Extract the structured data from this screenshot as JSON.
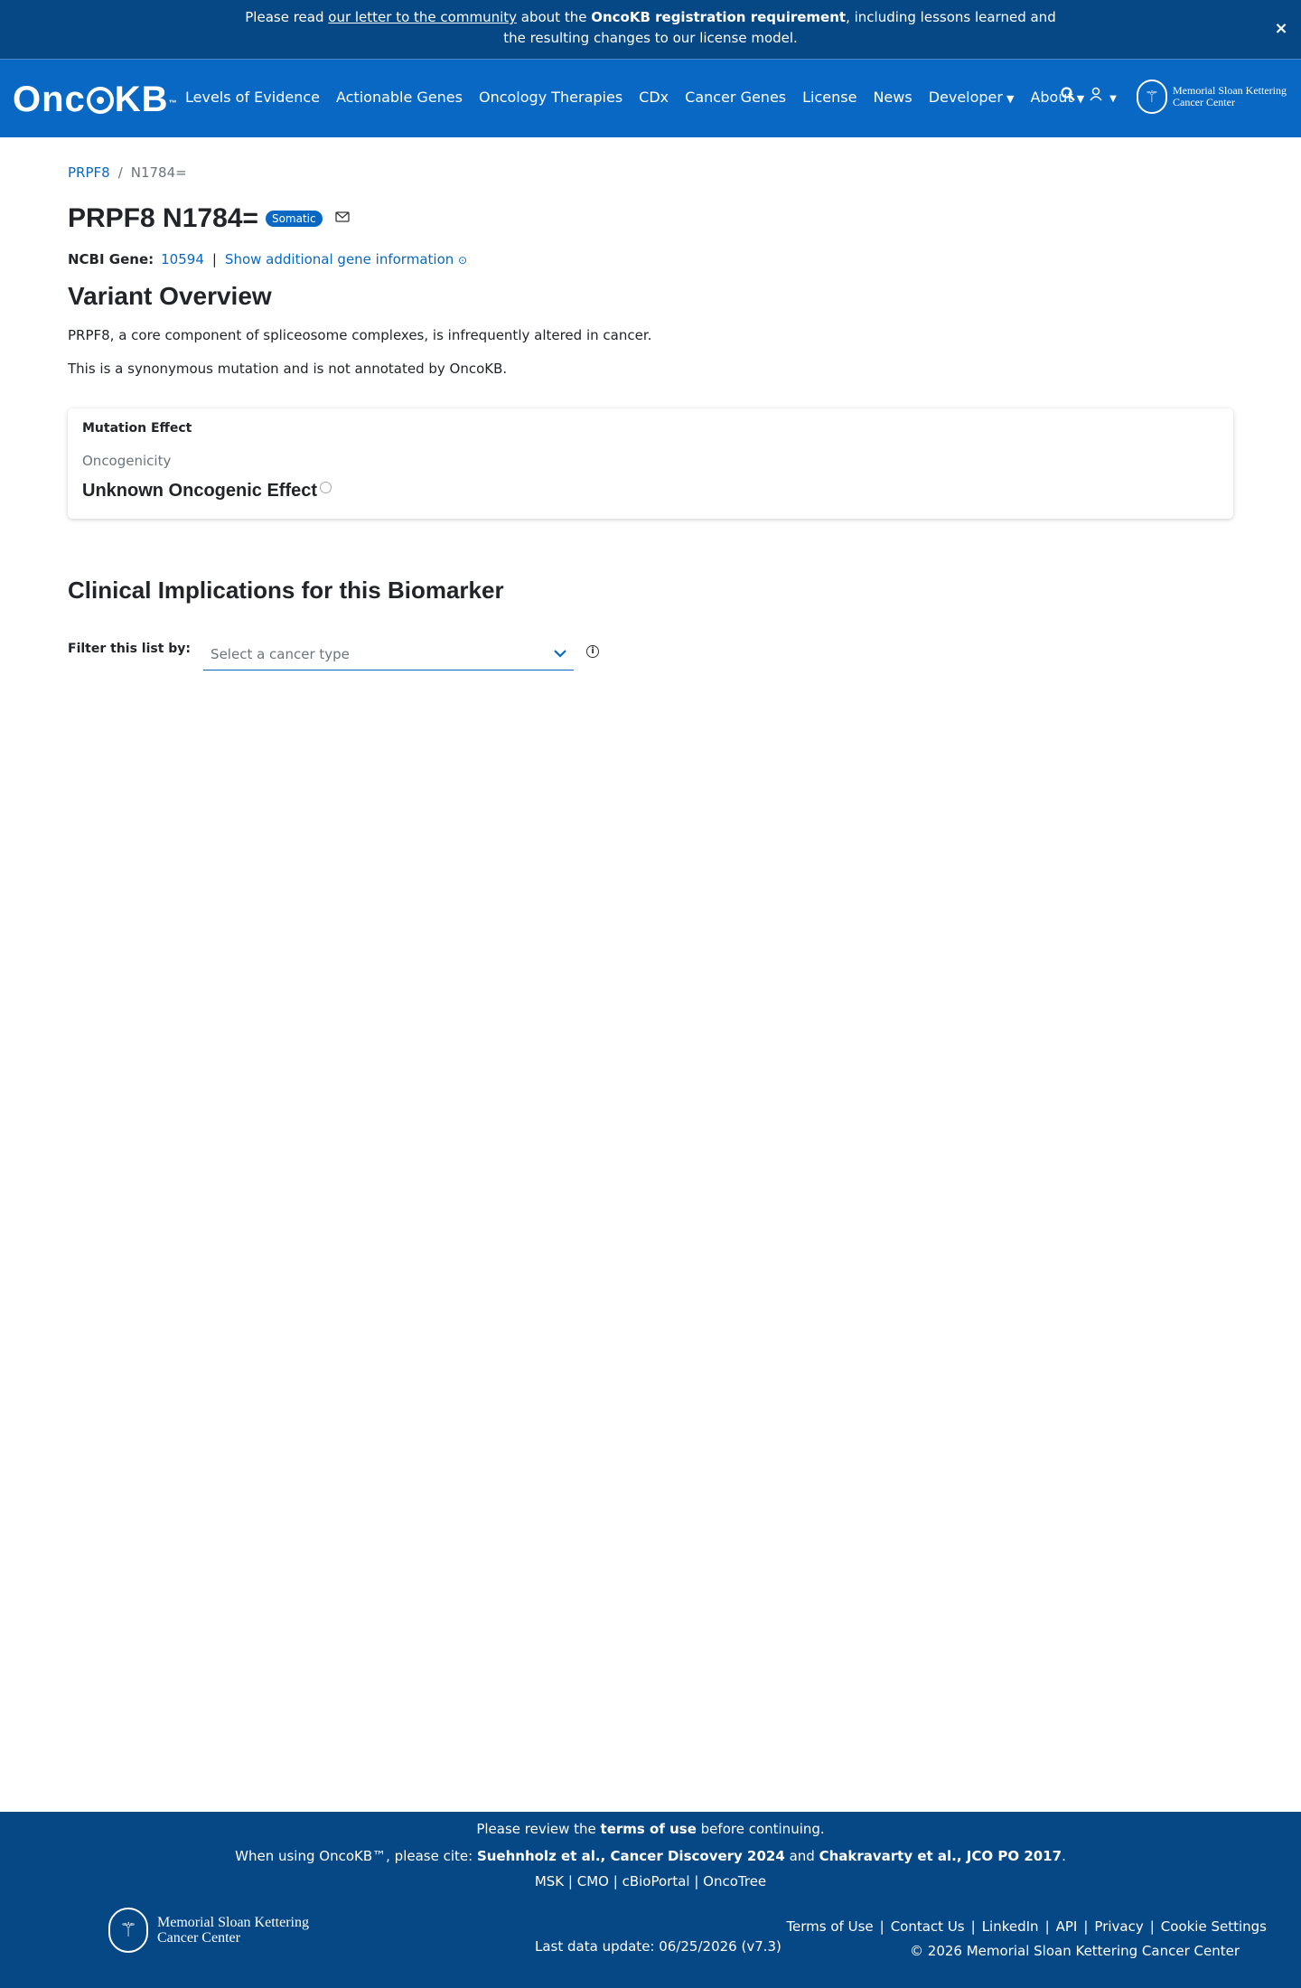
{
  "banner": {
    "prefix": "Please read ",
    "link": "our letter to the community",
    "middle": " about the ",
    "bold": "OncoKB registration requirement",
    "suffix": ", including lessons learned and",
    "line2": "the resulting changes to our license model.",
    "close": "×"
  },
  "nav": {
    "logo_left": "Onc",
    "logo_right": "KB",
    "logo_tm": "™",
    "items": [
      "Levels of Evidence",
      "Actionable Genes",
      "Oncology Therapies",
      "CDx",
      "Cancer Genes",
      "License",
      "News",
      "Developer",
      "About"
    ],
    "caret": "⌄",
    "msk_line1": "Memorial Sloan Kettering",
    "msk_line2": "Cancer Center"
  },
  "breadcrumb": {
    "gene": "PRPF8",
    "sep": "/",
    "current": "N1784="
  },
  "title": {
    "text": "PRPF8 N1784=",
    "badge": "Somatic"
  },
  "gene_info": {
    "label": "NCBI Gene:",
    "id": "10594",
    "bar": "|",
    "more": "Show additional gene information"
  },
  "overview": {
    "title": "Variant Overview",
    "p1": "PRPF8, a core component of spliceosome complexes, is infrequently altered in cancer.",
    "p2": "This is a synonymous mutation and is not annotated by OncoKB."
  },
  "mutation_effect": {
    "title": "Mutation Effect",
    "label": "Oncogenicity",
    "value": "Unknown Oncogenic Effect"
  },
  "clinical": {
    "title": "Clinical Implications for this Biomarker",
    "filter_label": "Filter this list by:",
    "select_placeholder": "Select a cancer type"
  },
  "footer": {
    "review_pre": "Please review the ",
    "review_bold": "terms of use",
    "review_post": " before continuing.",
    "cite_pre": "When using OncoKB™, please cite: ",
    "cite_1": "Suehnholz et al., Cancer Discovery 2024",
    "cite_and": " and ",
    "cite_2": "Chakravarty et al., JCO PO 2017",
    "cite_end": ".",
    "resources": [
      "MSK",
      "CMO",
      "cBioPortal",
      "OncoTree"
    ],
    "links": [
      "Terms of Use",
      "Contact Us",
      "LinkedIn",
      "API",
      "Privacy",
      "Cookie Settings"
    ],
    "update": "Last data update: 06/25/2026 (v7.3)",
    "copyright": "© 2026 Memorial Sloan Kettering Cancer Center",
    "msk_line1": "Memorial Sloan Kettering",
    "msk_line2": "Cancer Center"
  },
  "colors": {
    "banner": "#064786",
    "nav": "#0968c3",
    "link": "#0968c3",
    "footer": "#064786"
  },
  "icons": [
    "close-icon",
    "search-icon",
    "user-icon",
    "chevron-down-icon",
    "mail-icon",
    "info-icon",
    "msk-logo-icon"
  ]
}
